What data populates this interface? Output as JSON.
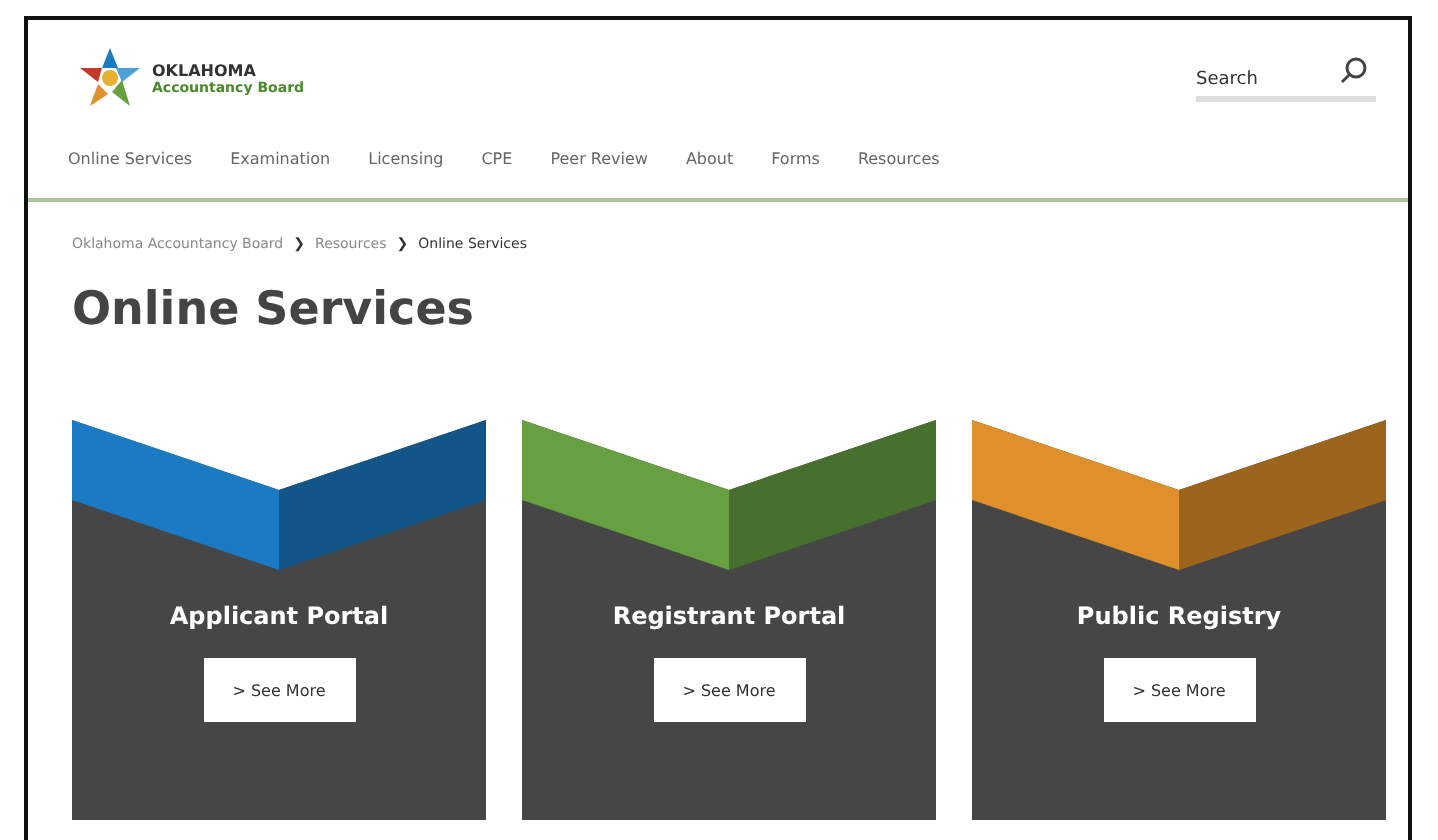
{
  "logo": {
    "line_1": "OKLAHOMA",
    "line_2": "Accountancy Board"
  },
  "search": {
    "placeholder": "Search"
  },
  "nav": [
    "Online Services",
    "Examination",
    "Licensing",
    "CPE",
    "Peer Review",
    "About",
    "Forms",
    "Resources"
  ],
  "breadcrumb": [
    {
      "label": "Oklahoma Accountancy Board",
      "current": false
    },
    {
      "label": "Resources",
      "current": false
    },
    {
      "label": "Online Services",
      "current": true
    }
  ],
  "breadcrumb_separator": "❯",
  "page_title": "Online Services",
  "cards": [
    {
      "title": "Applicant Portal",
      "button": "> See More",
      "color": "#1a7ac4"
    },
    {
      "title": "Registrant Portal",
      "button": "> See More",
      "color": "#66a041"
    },
    {
      "title": "Public Registry",
      "button": "> See More",
      "color": "#e0902a"
    }
  ]
}
